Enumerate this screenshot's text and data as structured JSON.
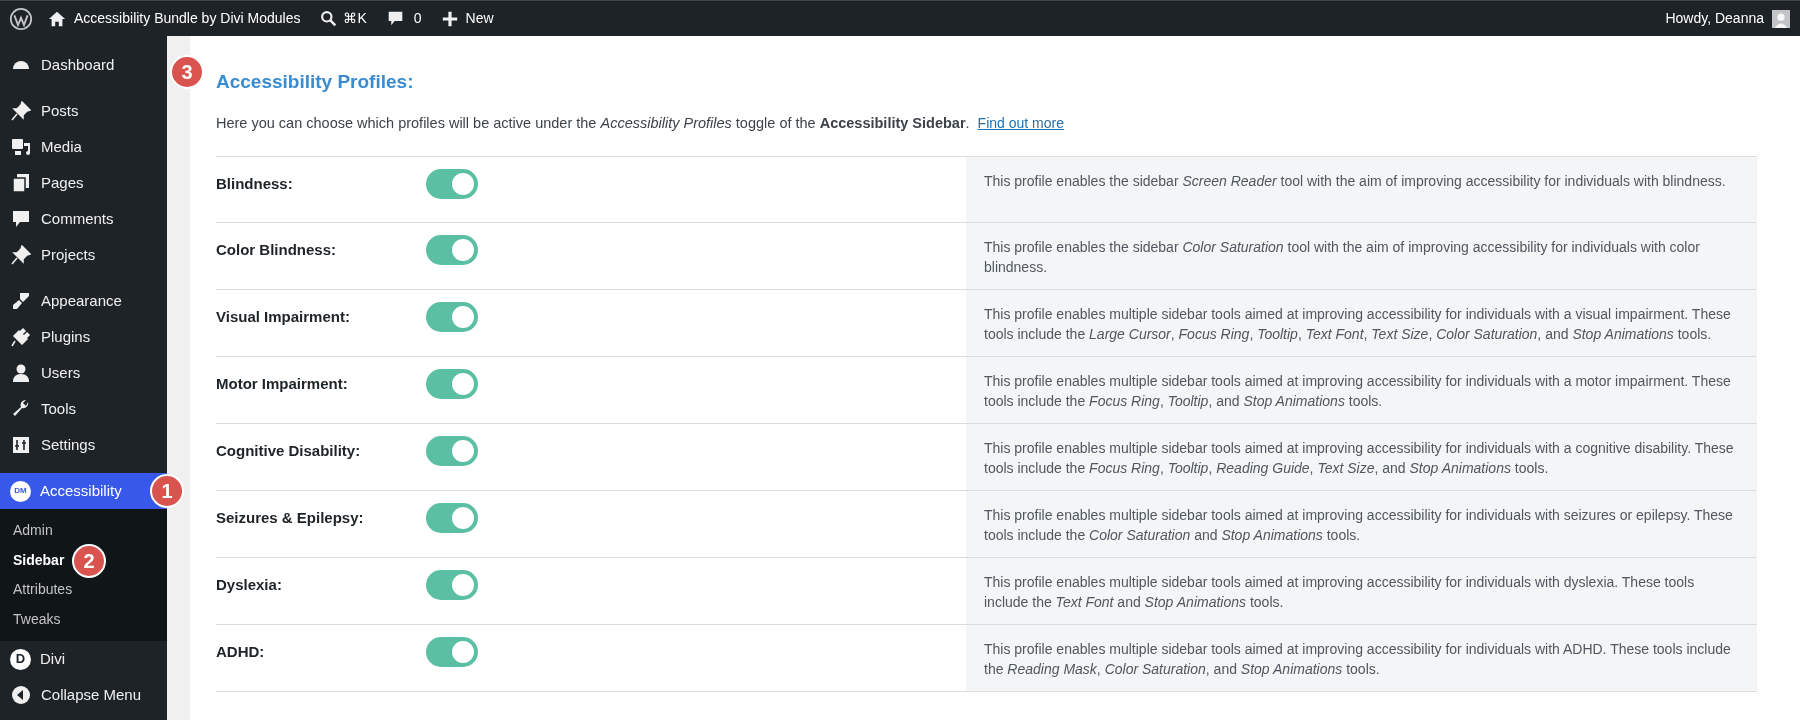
{
  "top_bar": {
    "site_title": "Accessibility Bundle by Divi Modules",
    "search_shortcut": "⌘K",
    "comments_count": "0",
    "new_label": "New",
    "greeting": "Howdy, Deanna"
  },
  "sidebar": {
    "groups": [
      [
        {
          "label": "Dashboard",
          "selected": false
        }
      ],
      [
        {
          "label": "Posts",
          "selected": false
        },
        {
          "label": "Media",
          "selected": false
        },
        {
          "label": "Pages",
          "selected": false
        },
        {
          "label": "Comments",
          "selected": false
        },
        {
          "label": "Projects",
          "selected": false
        }
      ],
      [
        {
          "label": "Appearance",
          "selected": false
        },
        {
          "label": "Plugins",
          "selected": false
        },
        {
          "label": "Users",
          "selected": false
        },
        {
          "label": "Tools",
          "selected": false
        },
        {
          "label": "Settings",
          "selected": false
        }
      ],
      [
        {
          "label": "Accessibility",
          "selected": true,
          "icon_text": "DM",
          "badge": "1",
          "children": [
            {
              "label": "Admin",
              "selected": false
            },
            {
              "label": "Sidebar",
              "selected": true,
              "badge": "2"
            },
            {
              "label": "Attributes",
              "selected": false
            },
            {
              "label": "Tweaks",
              "selected": false
            }
          ]
        },
        {
          "label": "Divi",
          "selected": false,
          "icon_text": "D"
        },
        {
          "label": "Collapse Menu",
          "selected": false
        }
      ]
    ]
  },
  "content": {
    "badge": "3",
    "heading": "Accessibility Profiles:",
    "intro": "Here you can choose which profiles will be active under the *Accessibility Profiles* toggle of the **Accessibility Sidebar**.",
    "link": "Find out more",
    "profiles": [
      {
        "label": "Blindness:",
        "on": true,
        "description": "This profile enables the sidebar *Screen Reader* tool with the aim of improving accessibility for individuals with blindness."
      },
      {
        "label": "Color Blindness:",
        "on": true,
        "description": "This profile enables the sidebar *Color Saturation* tool with the aim of improving accessibility for individuals with color blindness."
      },
      {
        "label": "Visual Impairment:",
        "on": true,
        "description": "This profile enables multiple sidebar tools aimed at improving accessibility for individuals with a visual impairment. These tools include the *Large Cursor*, *Focus Ring*, *Tooltip*, *Text Font*, *Text Size*, *Color Saturation*, and *Stop Animations* tools."
      },
      {
        "label": "Motor Impairment:",
        "on": true,
        "description": "This profile enables multiple sidebar tools aimed at improving accessibility for individuals with a motor impairment. These tools include the *Focus Ring*, *Tooltip*, and *Stop Animations* tools."
      },
      {
        "label": "Cognitive Disability:",
        "on": true,
        "description": "This profile enables multiple sidebar tools aimed at improving accessibility for individuals with a cognitive disability. These tools include the *Focus Ring*, *Tooltip*, *Reading Guide*, *Text Size*, and *Stop Animations* tools."
      },
      {
        "label": "Seizures & Epilepsy:",
        "on": true,
        "description": "This profile enables multiple sidebar tools aimed at improving accessibility for individuals with seizures or epilepsy. These tools include the *Color Saturation* and *Stop Animations* tools."
      },
      {
        "label": "Dyslexia:",
        "on": true,
        "description": "This profile enables multiple sidebar tools aimed at improving accessibility for individuals with dyslexia. These tools include the *Text Font* and *Stop Animations* tools."
      },
      {
        "label": "ADHD:",
        "on": true,
        "description": "This profile enables multiple sidebar tools aimed at improving accessibility for individuals with ADHD. These tools include the *Reading Mask*, *Color Saturation*, and *Stop Animations* tools."
      }
    ]
  }
}
